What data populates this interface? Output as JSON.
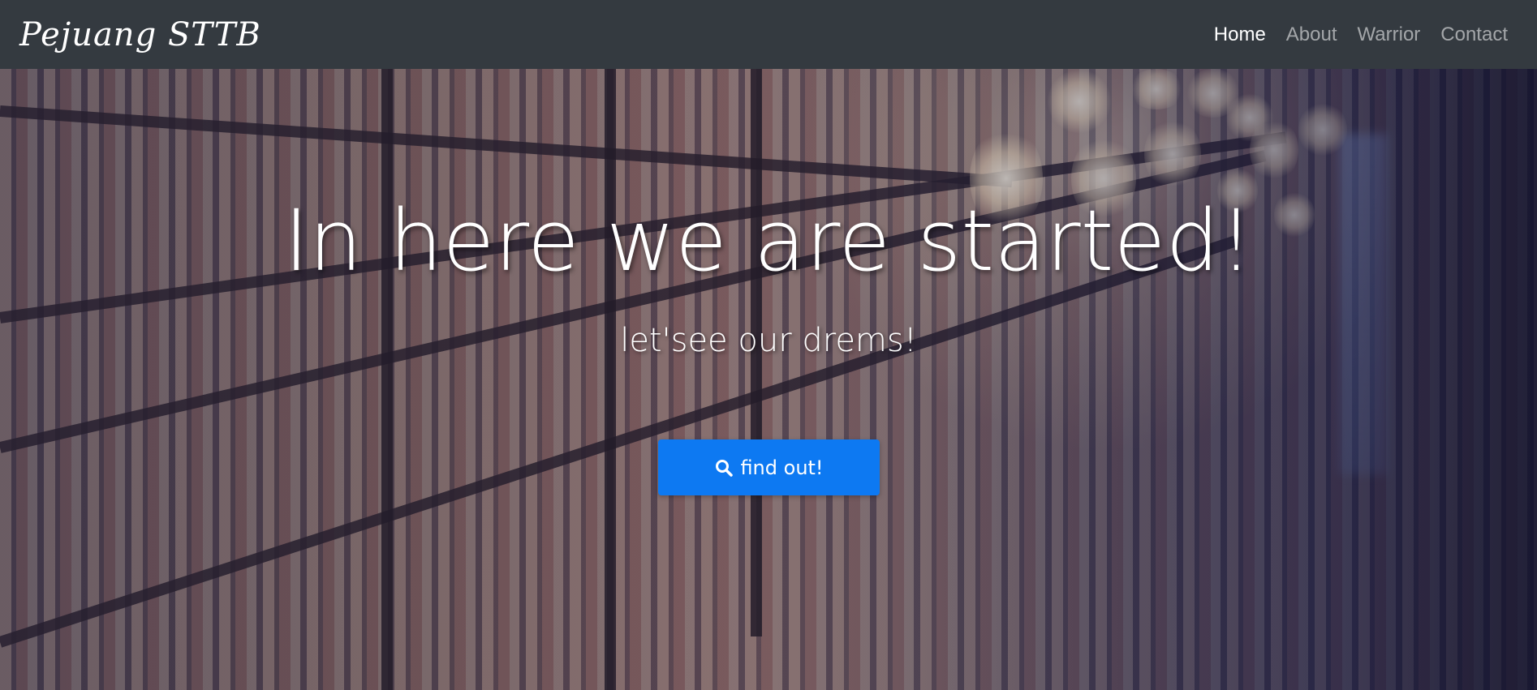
{
  "navbar": {
    "brand": "Pejuang STTB",
    "links": [
      {
        "label": "Home",
        "active": true
      },
      {
        "label": "About",
        "active": false
      },
      {
        "label": "Warrior",
        "active": false
      },
      {
        "label": "Contact",
        "active": false
      }
    ]
  },
  "hero": {
    "title": "In here we are started!",
    "subtitle": "let'see our drems!",
    "button": {
      "label": "find out!",
      "icon": "search-icon",
      "color": "#0d79f2"
    }
  },
  "colors": {
    "navbar_bg": "#343a40",
    "nav_active": "#ffffff",
    "nav_inactive": "rgba(255,255,255,0.55)"
  }
}
